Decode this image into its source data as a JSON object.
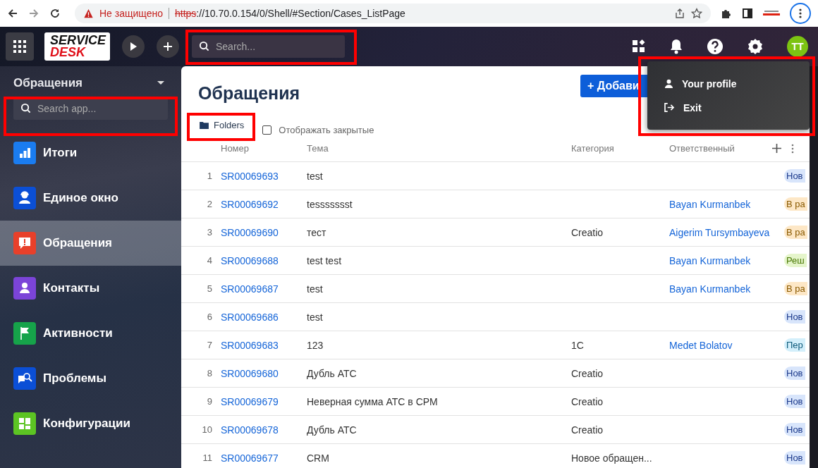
{
  "browser": {
    "security_label": "Не защищено",
    "url_scheme": "https",
    "url_rest": "://10.70.0.154/0/Shell/#Section/Cases_ListPage"
  },
  "header": {
    "logo_top": "SERVICE",
    "logo_bottom": "DESK",
    "search_placeholder": "Search...",
    "avatar": "TT"
  },
  "sidebar": {
    "title": "Обращения",
    "search_placeholder": "Search app...",
    "items": [
      {
        "label": "Итоги",
        "color": "#1a7cf0",
        "selected": false
      },
      {
        "label": "Единое окно",
        "color": "#0b4fd6",
        "selected": false
      },
      {
        "label": "Обращения",
        "color": "#e8402a",
        "selected": true
      },
      {
        "label": "Контакты",
        "color": "#7b44d8",
        "selected": false
      },
      {
        "label": "Активности",
        "color": "#16a34a",
        "selected": false
      },
      {
        "label": "Проблемы",
        "color": "#0b4fd6",
        "selected": false
      },
      {
        "label": "Конфигурации",
        "color": "#5cc423",
        "selected": false
      }
    ]
  },
  "page": {
    "title": "Обращения",
    "add_button": "+ Добави",
    "folders_button": "Folders",
    "show_closed": {
      "label": "Отображать закрытые",
      "checked": false
    }
  },
  "table": {
    "columns": [
      "Номер",
      "Тема",
      "Категория",
      "Ответственный"
    ],
    "rows": [
      {
        "index": "1",
        "number": "SR00069693",
        "subject": "test",
        "status": "Нов",
        "color": "#d8e5fb"
      },
      {
        "index": "2",
        "number": "SR00069692",
        "subject": "tessssssst",
        "responsible": "Bayan Kurmanbek",
        "status": "В ра",
        "color": "#fde7c6"
      },
      {
        "index": "3",
        "number": "SR00069690",
        "subject": "тест",
        "category": "Creatio",
        "responsible": "Aigerim Tursymbayeva",
        "status": "В ра",
        "color": "#fde7c6"
      },
      {
        "index": "4",
        "number": "SR00069688",
        "subject": "test test",
        "responsible": "Bayan Kurmanbek",
        "status": "Реш",
        "color": "#e5f5cb"
      },
      {
        "index": "5",
        "number": "SR00069687",
        "subject": "test",
        "responsible": "Bayan Kurmanbek",
        "status": "В ра",
        "color": "#fde7c6"
      },
      {
        "index": "6",
        "number": "SR00069686",
        "subject": "test",
        "status": "Нов",
        "color": "#d8e5fb"
      },
      {
        "index": "7",
        "number": "SR00069683",
        "subject": "123",
        "category": "1С",
        "responsible": "Medet Bolatov",
        "status": "Пер",
        "color": "#d3effb"
      },
      {
        "index": "8",
        "number": "SR00069680",
        "subject": "Дубль АТС",
        "category": "Creatio",
        "status": "Нов",
        "color": "#d8e5fb"
      },
      {
        "index": "9",
        "number": "SR00069679",
        "subject": "Неверная сумма АТС в СРМ",
        "category": "Creatio",
        "status": "Нов",
        "color": "#d8e5fb"
      },
      {
        "index": "10",
        "number": "SR00069678",
        "subject": "Дубль АТС",
        "category": "Creatio",
        "status": "Нов",
        "color": "#d8e5fb"
      },
      {
        "index": "11",
        "number": "SR00069677",
        "subject": "CRM",
        "category": "Новое обращен...",
        "status": "Нов",
        "color": "#d8e5fb"
      }
    ]
  },
  "profile_menu": {
    "items": [
      {
        "label": "Your profile"
      },
      {
        "label": "Exit"
      }
    ]
  }
}
